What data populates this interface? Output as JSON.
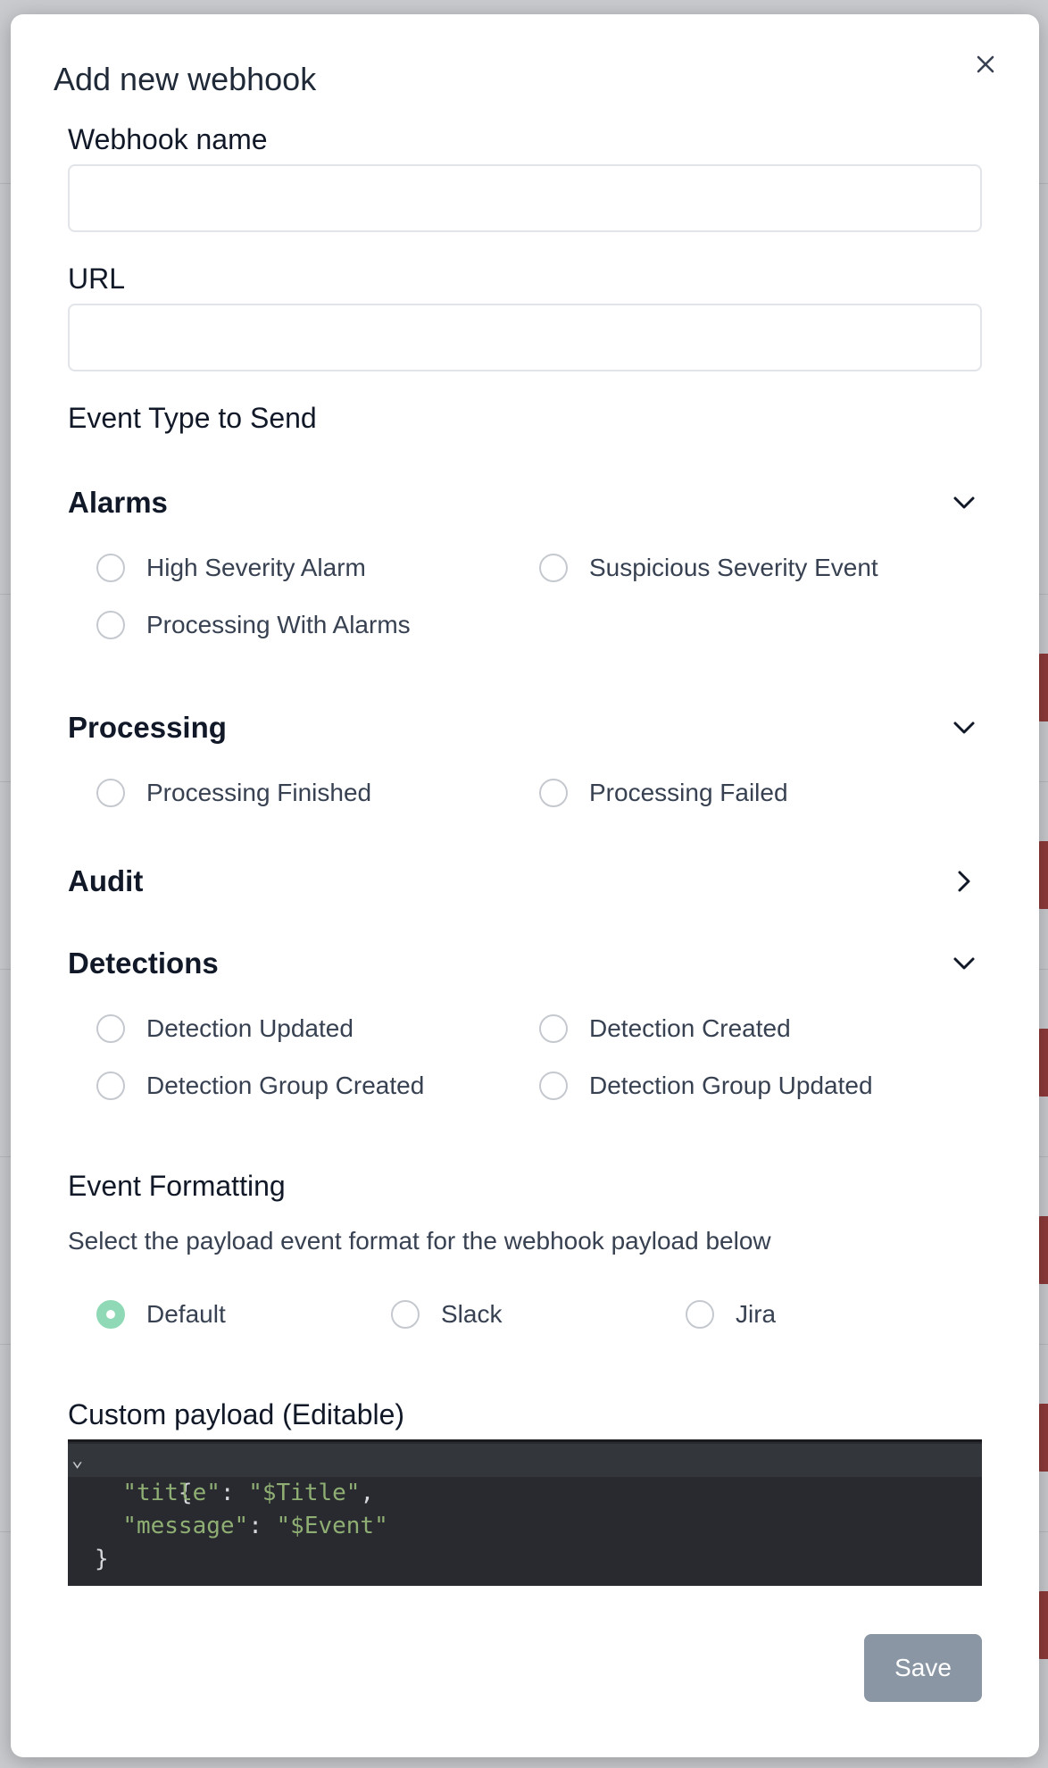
{
  "modal": {
    "title": "Add new webhook"
  },
  "form": {
    "webhook_name_label": "Webhook name",
    "webhook_name_value": "",
    "url_label": "URL",
    "url_value": "",
    "event_type_label": "Event Type to Send"
  },
  "groups": {
    "alarms": {
      "title": "Alarms",
      "expanded": true,
      "options": [
        "High Severity Alarm",
        "Suspicious Severity Event",
        "Processing With Alarms"
      ]
    },
    "processing": {
      "title": "Processing",
      "expanded": true,
      "options": [
        "Processing Finished",
        "Processing Failed"
      ]
    },
    "audit": {
      "title": "Audit",
      "expanded": false
    },
    "detections": {
      "title": "Detections",
      "expanded": true,
      "options": [
        "Detection Updated",
        "Detection Created",
        "Detection Group Created",
        "Detection Group Updated"
      ]
    }
  },
  "formatting": {
    "title": "Event Formatting",
    "description": "Select the payload event format for the webhook payload below",
    "options": [
      "Default",
      "Slack",
      "Jira"
    ],
    "selected": "Default"
  },
  "payload": {
    "label": "Custom payload (Editable)",
    "lines": [
      "{",
      "\"title\": \"$Title\",",
      "\"message\": \"$Event\"",
      "}"
    ],
    "title_key": "\"title\"",
    "title_value": "\"$Title\"",
    "message_key": "\"message\"",
    "message_value": "\"$Event\""
  },
  "actions": {
    "save_label": "Save"
  },
  "colors": {
    "accent_selected": "#8fd9b6",
    "save_button": "#8a96a3",
    "code_bg": "#282a2f",
    "code_string": "#8fae73"
  }
}
